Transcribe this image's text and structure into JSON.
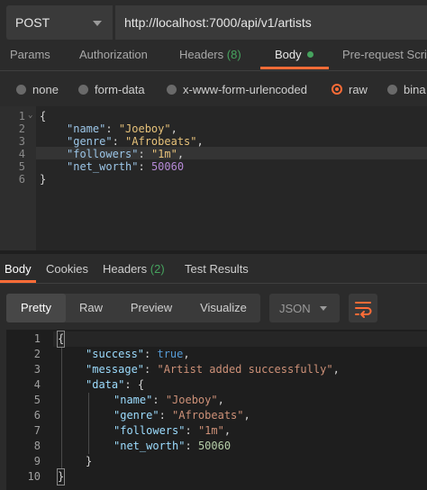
{
  "request": {
    "method": "POST",
    "url": "http://localhost:7000/api/v1/artists"
  },
  "request_tabs": {
    "params": "Params",
    "authorization": "Authorization",
    "headers": "Headers",
    "headers_count": "(8)",
    "body": "Body",
    "prerequest": "Pre-request Scri"
  },
  "body_modes": {
    "none": "none",
    "form_data": "form-data",
    "urlencoded": "x-www-form-urlencoded",
    "raw": "raw",
    "binary": "bina",
    "selected": "raw"
  },
  "request_body": {
    "line_numbers": [
      "1",
      "2",
      "3",
      "4",
      "5",
      "6"
    ],
    "open": "{",
    "close": "}",
    "fields": [
      {
        "key": "\"name\"",
        "value": "\"Joeboy\"",
        "sep": ","
      },
      {
        "key": "\"genre\"",
        "value": "\"Afrobeats\"",
        "sep": ","
      },
      {
        "key": "\"followers\"",
        "value": "\"1m\"",
        "sep": ","
      },
      {
        "key": "\"net_worth\"",
        "value": "50060",
        "sep": ""
      }
    ]
  },
  "response_tabs": {
    "body": "Body",
    "cookies": "Cookies",
    "headers": "Headers",
    "headers_count": "(2)",
    "test_results": "Test Results"
  },
  "response_view": {
    "pretty": "Pretty",
    "raw": "Raw",
    "preview": "Preview",
    "visualize": "Visualize",
    "format": "JSON",
    "selected": "Pretty"
  },
  "response_body": {
    "line_numbers": [
      "1",
      "2",
      "3",
      "4",
      "5",
      "6",
      "7",
      "8",
      "9",
      "10"
    ],
    "open": "{",
    "close": "}",
    "success_key": "\"success\"",
    "success_val": "true",
    "message_key": "\"message\"",
    "message_val": "\"Artist added successfully\"",
    "data_key": "\"data\"",
    "data_open": "{",
    "data_close": "}",
    "data_fields": [
      {
        "key": "\"name\"",
        "value": "\"Joeboy\"",
        "sep": ","
      },
      {
        "key": "\"genre\"",
        "value": "\"Afrobeats\"",
        "sep": ","
      },
      {
        "key": "\"followers\"",
        "value": "\"1m\"",
        "sep": ","
      },
      {
        "key": "\"net_worth\"",
        "value": "50060",
        "sep": ""
      }
    ]
  },
  "colors": {
    "accent": "#ff6c37",
    "count_green": "#46a35e",
    "background": "#2b2b2b"
  },
  "icons": {
    "method_dropdown": "chevron-down-icon",
    "format_dropdown": "chevron-down-icon",
    "wrap": "wrap-lines-icon",
    "fold": "fold-caret-icon",
    "body_status": "dot-icon"
  }
}
